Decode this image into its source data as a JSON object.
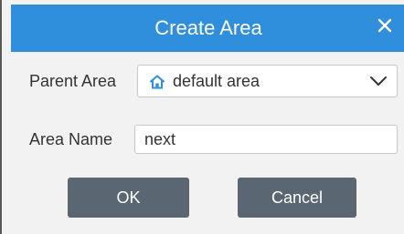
{
  "dialog": {
    "title": "Create Area",
    "close_icon": "close-icon"
  },
  "form": {
    "parent_area": {
      "label": "Parent Area",
      "value": "default area",
      "icon": "home-icon",
      "dropdown_icon": "chevron-down-icon"
    },
    "area_name": {
      "label": "Area Name",
      "value": "next"
    }
  },
  "buttons": {
    "ok_label": "OK",
    "cancel_label": "Cancel"
  },
  "colors": {
    "titlebar": "#2f8fdc",
    "button": "#5b6673",
    "home_icon": "#2f8fdc",
    "background": "#f2f2f2"
  }
}
